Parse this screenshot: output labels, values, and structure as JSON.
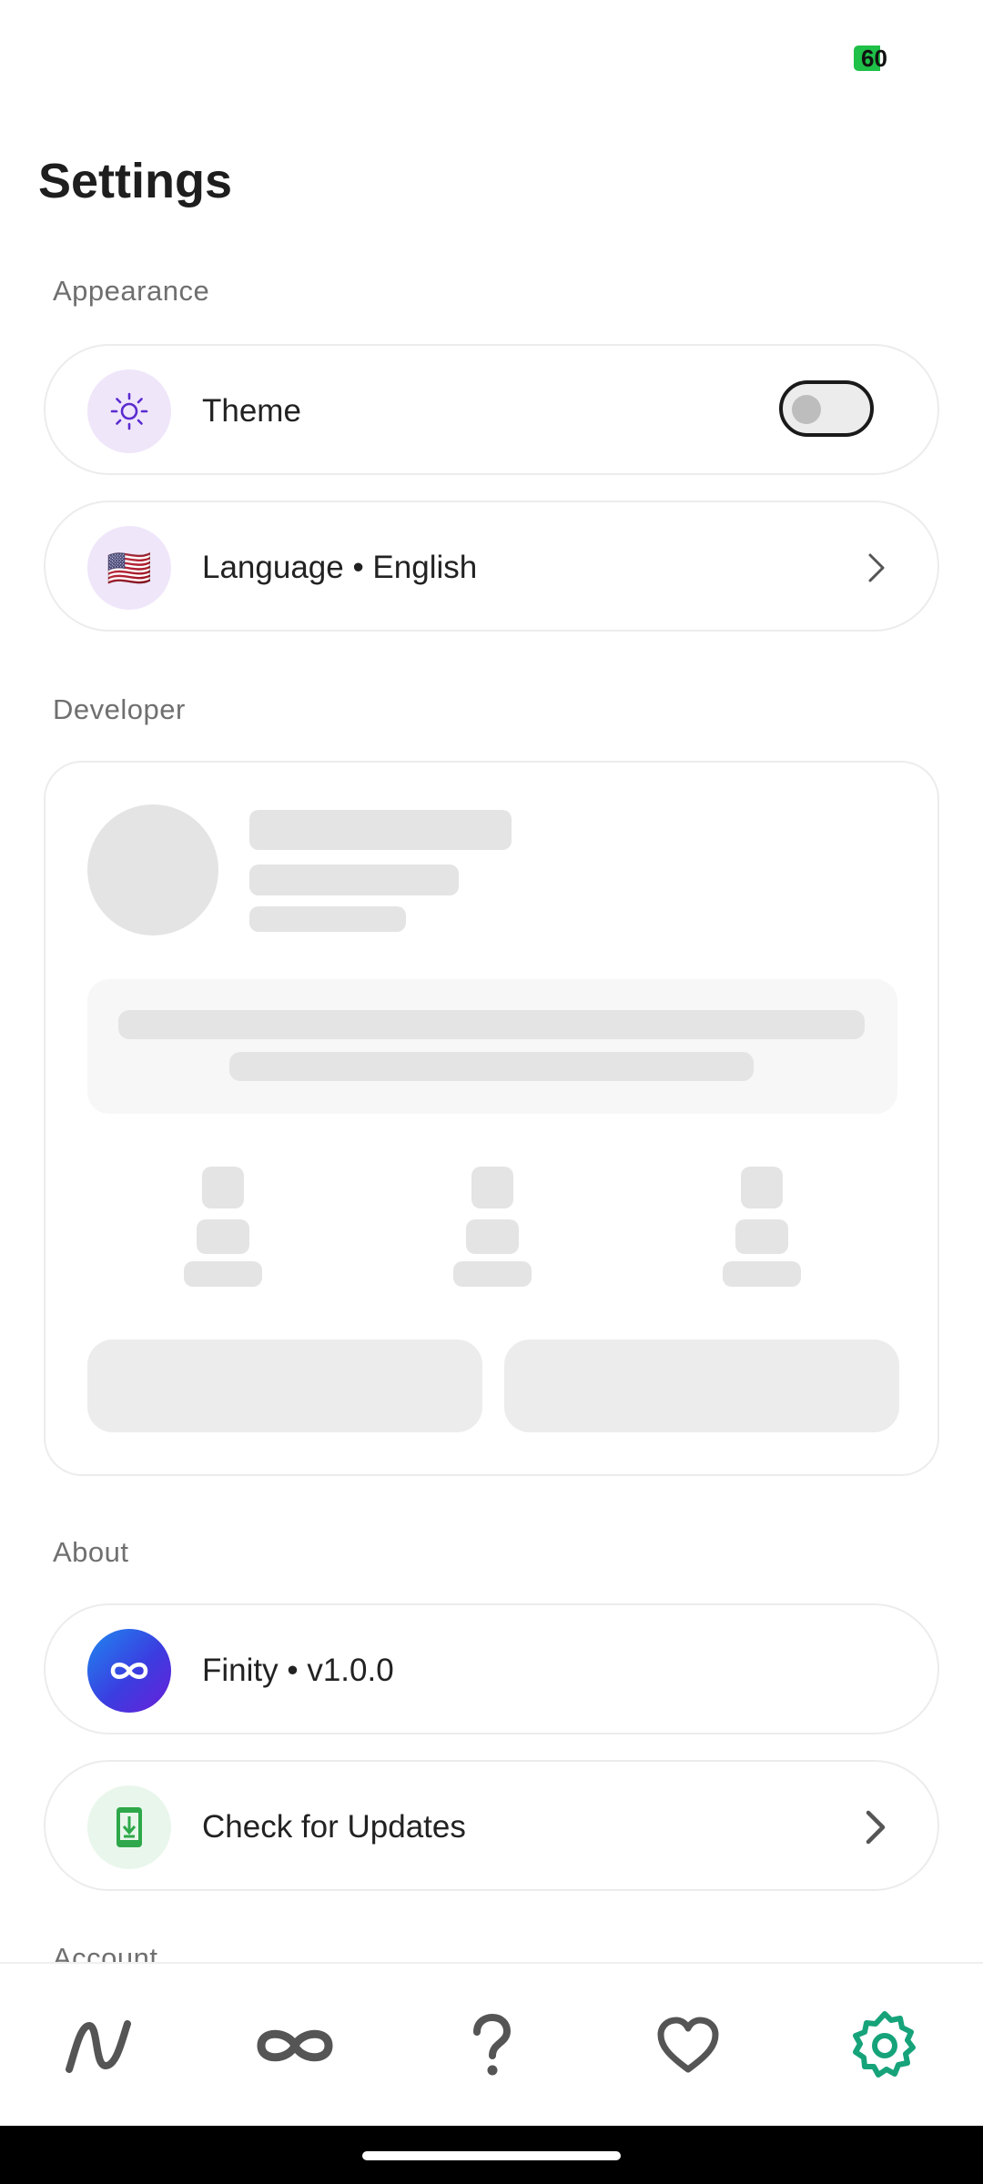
{
  "status_bar": {
    "battery_level": "60"
  },
  "page": {
    "title": "Settings"
  },
  "sections": {
    "appearance": "Appearance",
    "developer": "Developer",
    "about": "About",
    "account_partial": "Account"
  },
  "theme_row": {
    "label": "Theme",
    "icon": "sun-icon",
    "toggle_on": false
  },
  "language_row": {
    "label": "Language • English",
    "icon": "us-flag-icon",
    "flag": "🇺🇸"
  },
  "about_row": {
    "label": "Finity • v1.0.0",
    "icon": "infinity-logo-icon"
  },
  "updates_row": {
    "label": "Check for Updates",
    "icon": "download-phone-icon"
  },
  "nav": {
    "items": [
      {
        "icon": "wave-icon"
      },
      {
        "icon": "infinity-icon"
      },
      {
        "icon": "question-icon"
      },
      {
        "icon": "heart-icon"
      },
      {
        "icon": "settings-gear-icon",
        "active": true
      }
    ],
    "active_color": "#16a37a",
    "inactive_color": "#555555"
  },
  "colors": {
    "icon_bg_purple": "#efe6fa",
    "icon_purple": "#5b2bd0",
    "icon_bg_green": "#e9f6ec",
    "icon_green": "#2ea84a",
    "skeleton": "#e4e4e4"
  }
}
